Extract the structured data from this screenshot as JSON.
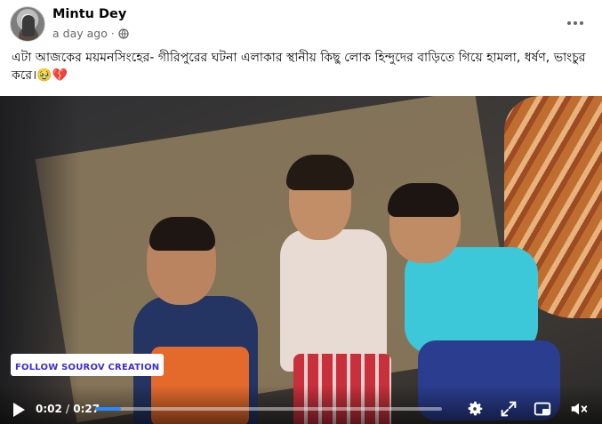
{
  "post": {
    "author": "Mintu Dey",
    "timestamp": "a day ago",
    "dot": "·",
    "caption": "এটা আজকের ময়মনসিংহের- গীরিপুরের ঘটনা এলাকার স্থানীয় কিছু লোক হিন্দুদের বাড়িতে গিয়ে হামলা, ধর্ষণ, ভাংচুর করে।🥹💔"
  },
  "video": {
    "watermark": "FOLLOW SOUROV CREATION",
    "current_time": "0:02",
    "separator": "/",
    "duration": "0:27",
    "progress_fraction": 0.074
  },
  "icons": {
    "more": "more-horizontal-icon",
    "audience": "globe-icon",
    "play": "play-icon",
    "settings": "gear-icon",
    "fullscreen": "expand-icon",
    "pip": "picture-in-picture-icon",
    "volume": "volume-muted-icon"
  },
  "colors": {
    "progress": "#2d88ff",
    "watermark_text": "#3b2fc9",
    "meta_text": "#65676b"
  }
}
